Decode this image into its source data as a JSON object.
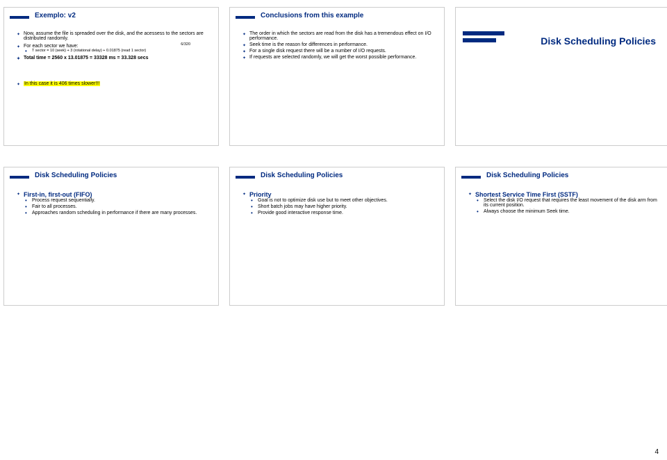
{
  "page_number": "4",
  "slides": {
    "s1": {
      "title": "Exemplo: v2",
      "p1": "Now, assume the file is spreaded over the disk, and the acessess to the sectors are distributed randomly.",
      "p2": "For each sector we have:",
      "annot": "6/320",
      "p3": "T sector = 10 (seek) + 3 (rotational delay) + 0.01875 (read 1 sector)",
      "p4": "Total time = 2560 x 13.01875 = 33328 ms = 33.328 secs",
      "p5": "In this case it is 406 times slower!!!"
    },
    "s2": {
      "title": "Conclusions from this example",
      "b1": "The order in which the sectors are read from the disk has a tremendous effect on I/O performance.",
      "b2": "Seek time is the reason for differences in performance.",
      "b3": "For a single disk request there will be a number of I/O requests.",
      "b4": "If requests are selected randomly, we will get the worst possible performance."
    },
    "s3": {
      "title": "Disk Scheduling Policies"
    },
    "s4": {
      "title": "Disk Scheduling Policies",
      "h1": "First-in, first-out (FIFO)",
      "b1": "Process request sequentially.",
      "b2": "Fair to all processes.",
      "b3": "Approaches random scheduling in performance if there are many processes."
    },
    "s5": {
      "title": "Disk Scheduling Policies",
      "h1": "Priority",
      "b1": "Goal is not to optimize disk use but to meet other objectives.",
      "b2": "Short batch jobs may have higher priority.",
      "b3": "Provide good interactive response time."
    },
    "s6": {
      "title": "Disk Scheduling Policies",
      "h1": "Shortest Service Time First (SSTF)",
      "b1": "Select the disk I/O request that requires the least movement of the disk arm from its current position.",
      "b2": "Always choose the minimum Seek time."
    }
  }
}
